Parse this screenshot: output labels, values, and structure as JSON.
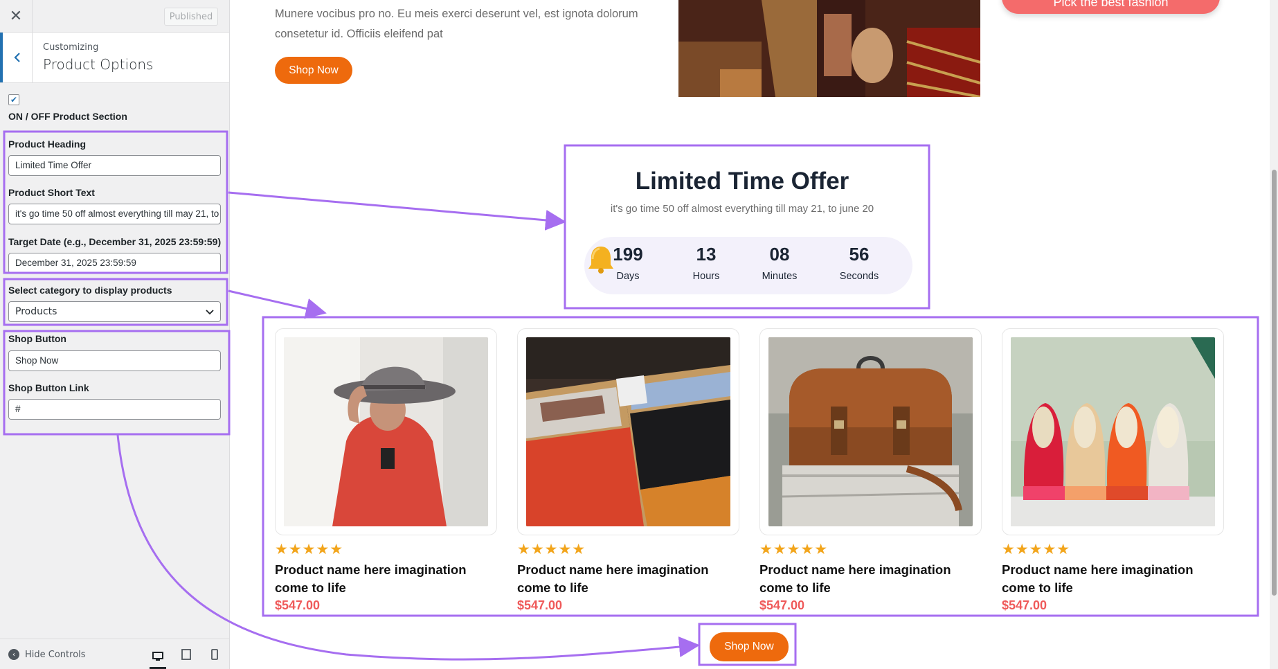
{
  "sidebar": {
    "publish_label": "Published",
    "customizing_label": "Customizing",
    "section_title": "Product Options",
    "toggle_checked": true,
    "toggle_label": "ON / OFF Product Section",
    "product_heading": {
      "label": "Product Heading",
      "value": "Limited Time Offer"
    },
    "product_short_text": {
      "label": "Product Short Text",
      "value": "it's go time 50 off almost everything till may 21, to june 20"
    },
    "target_date": {
      "label": "Target Date (e.g., December 31, 2025 23:59:59)",
      "value": "December 31, 2025 23:59:59"
    },
    "category": {
      "label": "Select category to display products",
      "value": "Products"
    },
    "shop_button": {
      "label": "Shop Button",
      "value": "Shop Now"
    },
    "shop_button_link": {
      "label": "Shop Button Link",
      "value": "#"
    },
    "hide_controls_label": "Hide Controls"
  },
  "preview": {
    "hero_text": "Munere vocibus pro no. Eu meis exerci deserunt vel, est ignota dolorum consetetur id. Officiis eleifend pat",
    "hero_button": "Shop Now",
    "pick_button": "Pick the best fashion",
    "offer_heading": "Limited Time Offer",
    "offer_subtext": "it's go time 50 off almost everything till may 21, to june 20",
    "countdown": [
      {
        "value": "199",
        "label": "Days"
      },
      {
        "value": "13",
        "label": "Hours"
      },
      {
        "value": "08",
        "label": "Minutes"
      },
      {
        "value": "56",
        "label": "Seconds"
      }
    ],
    "products": [
      {
        "stars": "★★★★★",
        "name": "Product name here imagination come to life",
        "price": "$547.00",
        "image": "woman-in-red-with-hat"
      },
      {
        "stars": "★★★★★",
        "name": "Product name here imagination come to life",
        "price": "$547.00",
        "image": "folded-sweaters"
      },
      {
        "stars": "★★★★★",
        "name": "Product name here imagination come to life",
        "price": "$547.00",
        "image": "leather-bag"
      },
      {
        "stars": "★★★★★",
        "name": "Product name here imagination come to life",
        "price": "$547.00",
        "image": "colorful-shoes"
      }
    ],
    "bottom_button": "Shop Now"
  },
  "colors": {
    "accent_orange": "#ee6a0d",
    "price_red": "#ef5a5a",
    "star_gold": "#f2a51c",
    "annotation_purple": "#a66ef0",
    "wp_blue": "#2271b1"
  }
}
